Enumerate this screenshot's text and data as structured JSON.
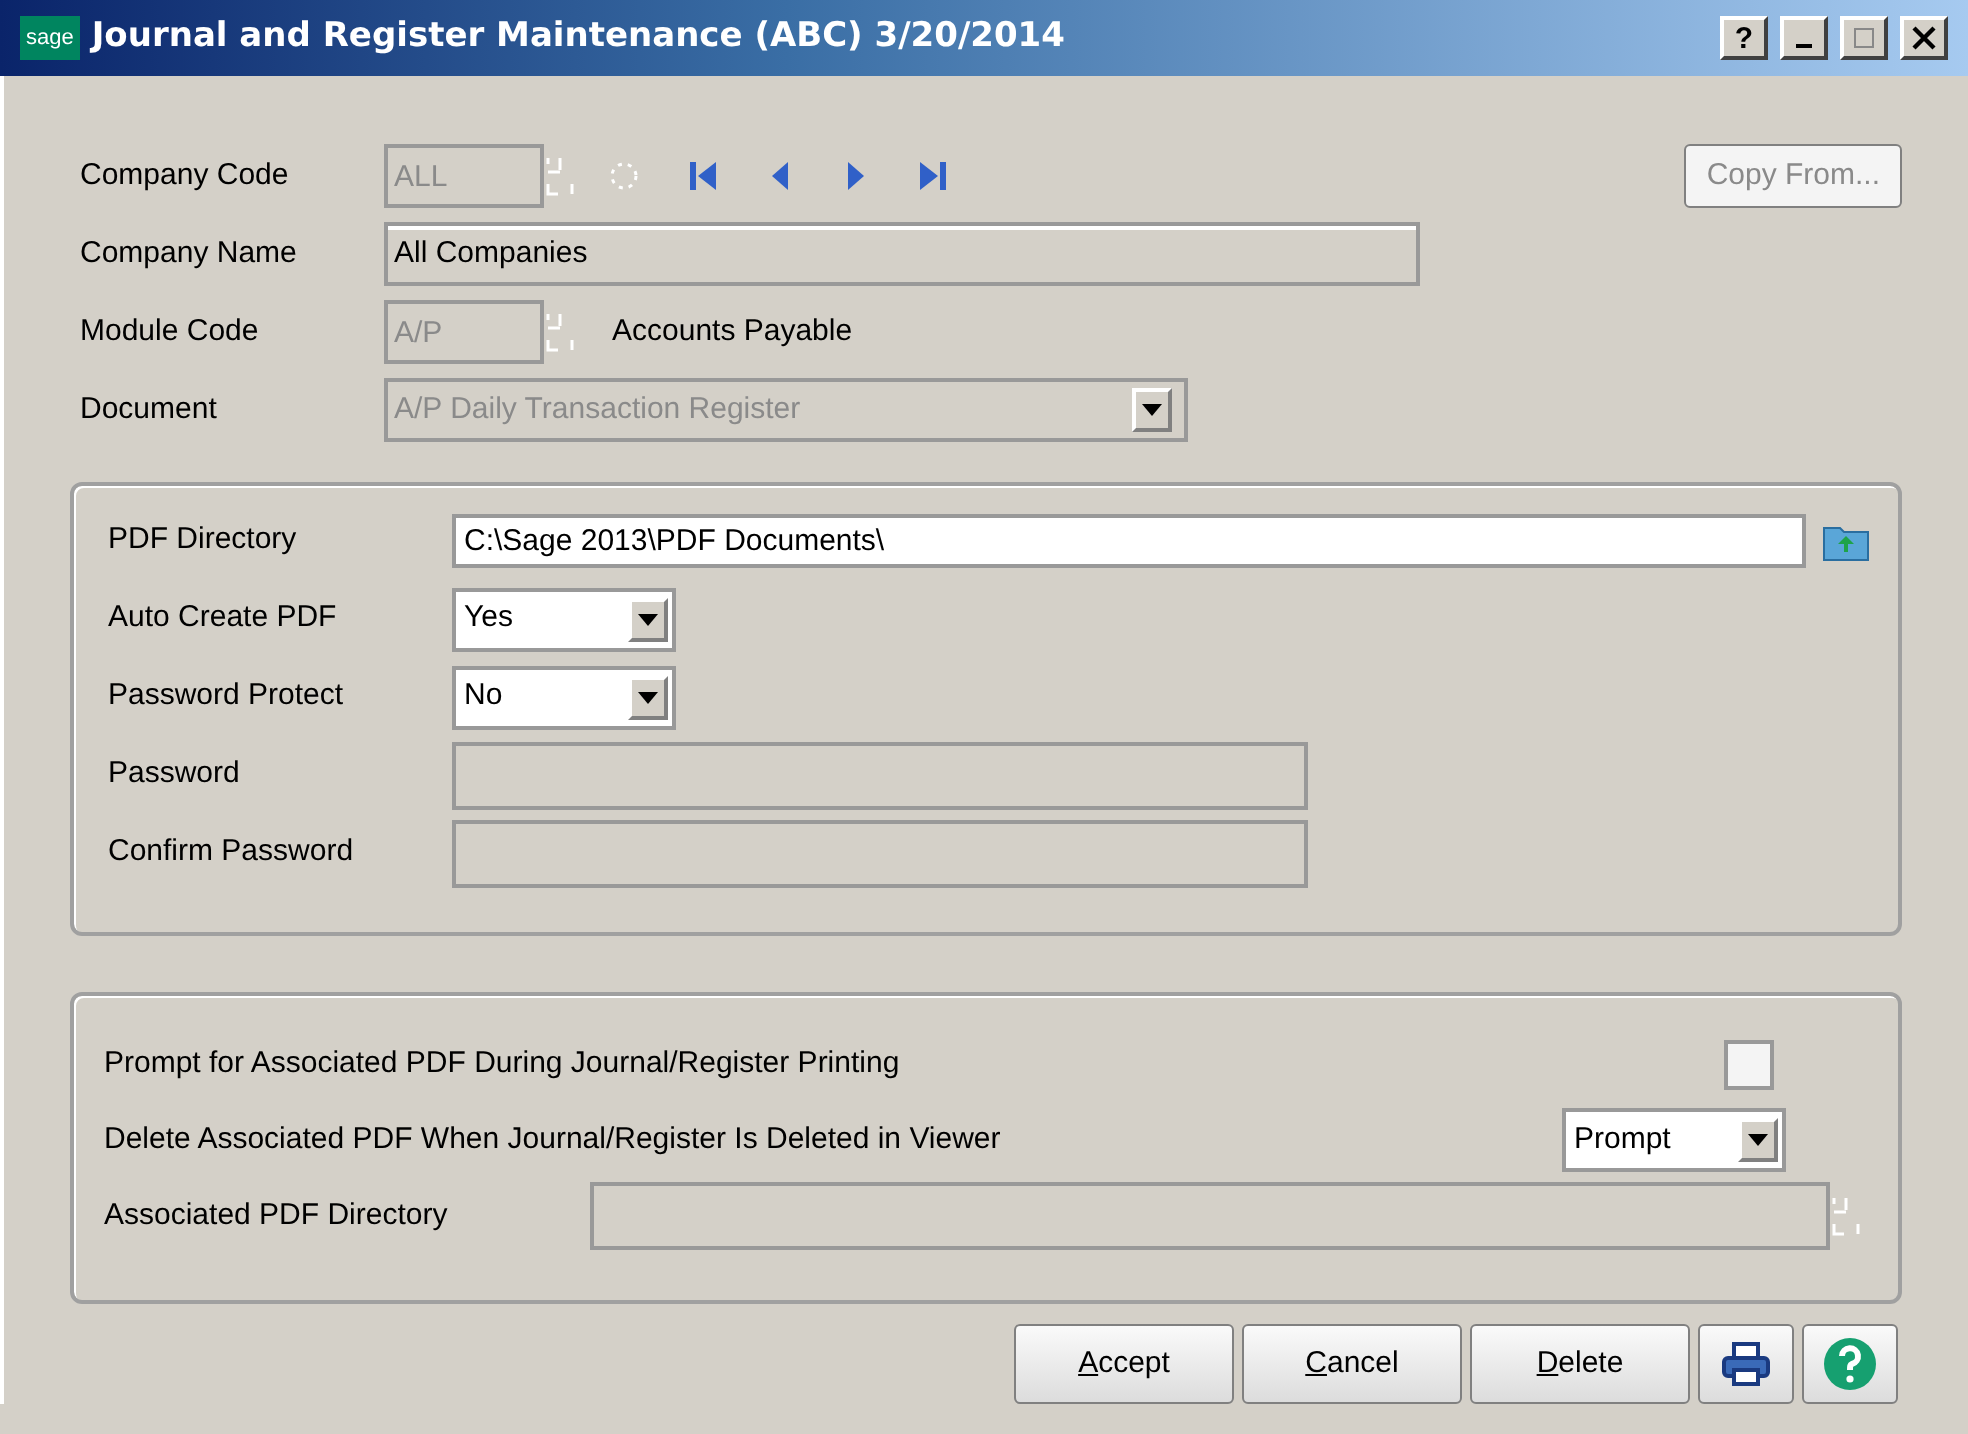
{
  "window": {
    "logo": "sage",
    "title": "Journal and Register Maintenance (ABC) 3/20/2014",
    "help": "?"
  },
  "header": {
    "copy_from": {
      "label": "Copy From...",
      "disabled": true
    },
    "fields": [
      {
        "kind": "code",
        "label": "Company Code",
        "value": "ALL",
        "disabled": true,
        "nav": true
      },
      {
        "kind": "text",
        "label": "Company Name",
        "value": "All Companies",
        "disabled": false
      },
      {
        "kind": "code",
        "label": "Module Code",
        "value": "A/P",
        "disabled": true,
        "description": "Accounts Payable"
      },
      {
        "kind": "dropdown",
        "label": "Document",
        "value": "A/P Daily Transaction Register",
        "disabled": true
      }
    ]
  },
  "pdf_settings": [
    {
      "kind": "path",
      "label": "PDF Directory",
      "value": "C:\\Sage 2013\\PDF Documents\\",
      "disabled": false
    },
    {
      "kind": "dropdown",
      "label": "Auto Create PDF",
      "value": "Yes",
      "disabled": false
    },
    {
      "kind": "dropdown",
      "label": "Password Protect",
      "value": "No",
      "disabled": false
    },
    {
      "kind": "text",
      "label": "Password",
      "disabled": true
    },
    {
      "kind": "text",
      "label": "Confirm Password",
      "disabled": true
    }
  ],
  "associated": [
    {
      "kind": "checkbox",
      "label": "Prompt for Associated PDF During Journal/Register Printing",
      "checked": false
    },
    {
      "kind": "dropdown",
      "label": "Delete Associated PDF When Journal/Register Is Deleted in Viewer",
      "value": "Prompt"
    },
    {
      "kind": "path",
      "label": "Associated PDF Directory",
      "disabled": true
    }
  ],
  "buttons": [
    "Accept",
    "Cancel",
    "Delete"
  ]
}
